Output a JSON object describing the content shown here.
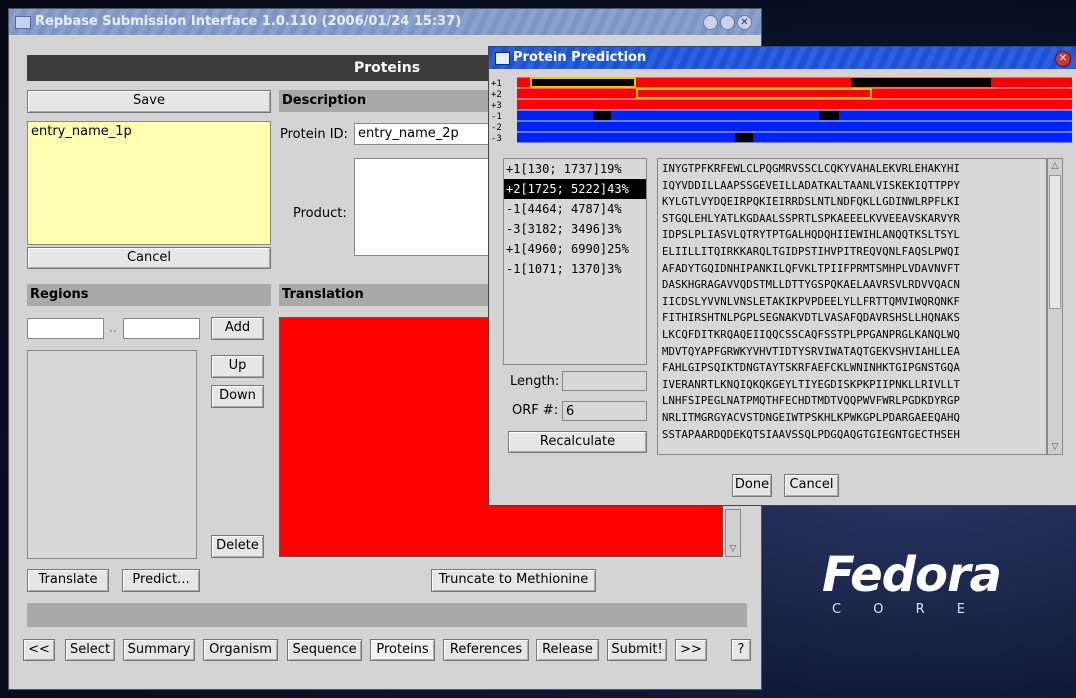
{
  "main_window": {
    "title": "Repbase Submission Interface 1.0.110 (2006/01/24 15:37)",
    "header": "Proteins",
    "save_label": "Save",
    "entry_list": [
      "entry_name_1p"
    ],
    "cancel_label": "Cancel",
    "description_label": "Description",
    "protein_id_label": "Protein ID:",
    "protein_id_value": "entry_name_2p",
    "product_label": "Product:",
    "regions_label": "Regions",
    "region_separator": "..",
    "add_label": "Add",
    "up_label": "Up",
    "down_label": "Down",
    "delete_label": "Delete",
    "translation_label": "Translation",
    "translate_label": "Translate",
    "predict_label": "Predict...",
    "truncate_label": "Truncate to Methionine",
    "tabs": [
      "<<",
      "Select",
      "Summary",
      "Organism",
      "Sequence",
      "Proteins",
      "References",
      "Release",
      "Submit!",
      ">>",
      "?"
    ],
    "active_tab": "Proteins",
    "translation_color": "#ff0000"
  },
  "popup": {
    "title": "Protein Prediction",
    "frame_labels": [
      "+1",
      "+2",
      "+3",
      "-1",
      "-2",
      "-3"
    ],
    "forward_color": "#ff0000",
    "reverse_color": "#0022ff",
    "highlight_color": "#f2c200",
    "orfs": [
      "+1[130; 1737]19%",
      "+2[1725; 5222]43%",
      "-1[4464; 4787]4%",
      "-3[3182; 3496]3%",
      "+1[4960; 6990]25%",
      "-1[1071; 1370]3%"
    ],
    "selected_orf": 1,
    "length_label": "Length:",
    "length_value": "",
    "orf_num_label": "ORF #:",
    "orf_num_value": "6",
    "recalculate_label": "Recalculate",
    "sequence_lines": [
      "INYGTPFKRFEWLCLPQGMRVSSCLCQKYVAHALEKVRLEHAKYHI",
      "IQYVDDILLAAPSSGEVEILLADATKALTAANLVISKEKIQTTPPY",
      "KYLGTLVYDQEIRPQKIEIRRDSLNTLNDFQKLLGDINWLRPFLKI",
      "STGQLEHLYATLKGDAALSSPRTLSPKAEEELKVVEEAVSKARVYR",
      "IDPSLPLIASVLQTRYTPTGALHQDQHIIEWIHLANQQTKSLTSYL",
      "ELIILLITQIRKKARQLTGIDPSTIHVPITREQVQNLFAQSLPWQI",
      "AFADYTGQIDNHIPANKILQFVKLTPIIFPRMTSMHPLVDAVNVFT",
      "DASKHGRAGAVVQDSTMLLDTTYGSPQKAELAAVRSVLRDVVQACN",
      "IICDSLYVVNLVNSLETAKIKPVPDEELYLLFRTTQMVIWQRQNKF",
      "FITHIRSHTNLPGPLSEGNAKVDTLVASAFQDAVRSHSLLHQNAKS",
      "LKCQFDITKRQAQEIIQQCSSCAQFSSTPLPPGANPRGLKANQLWQ",
      "MDVTQYAPFGRWKYVHVTIDTYSRVIWATAQTGEKVSHVIAHLLEA",
      "FAHLGIPSQIKTDNGTAYTSKRFAEFCKLWNINHKTGIPGNSTGQA",
      "IVERANRTLKNQIQKQKGEYLTIYEGDISKPKPIIPNKLLRIVLLT",
      "LNHFSIPEGLNATPMQTHFECHDTMDTVQQPWVFWRLPGDKDYRGP",
      "NRLITMGRGYACVSTDNGEIWTPSKHLKPWKGPLPDARGAEEQAHQ",
      "SSTAPAARDQDEKQTSIAAVSSQLPDGQAQGTGIEGNTGECTHSEH"
    ],
    "done_label": "Done",
    "cancel_label": "Cancel"
  },
  "desktop": {
    "brand": "Fedora",
    "sub_brand": "C O R E"
  }
}
